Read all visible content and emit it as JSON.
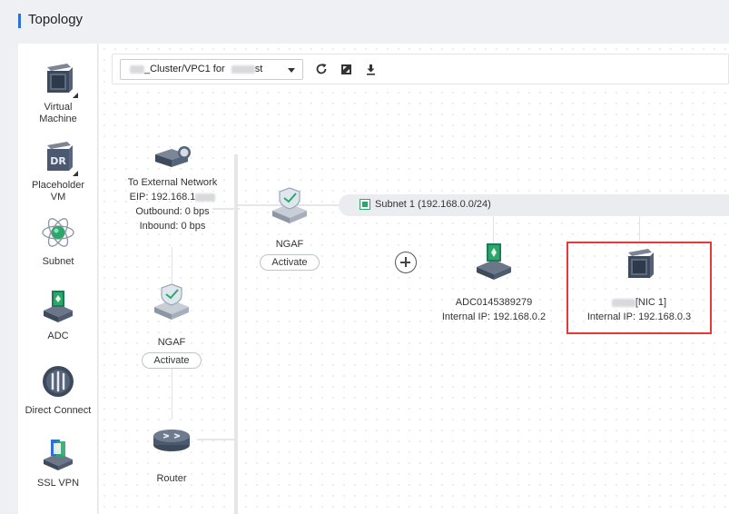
{
  "page": {
    "title": "Topology"
  },
  "palette": {
    "items": [
      {
        "label": "Virtual\nMachine",
        "icon": "vm-server-icon"
      },
      {
        "label": "Placeholder\nVM",
        "icon": "dr-server-icon"
      },
      {
        "label": "Subnet",
        "icon": "subnet-globe-icon"
      },
      {
        "label": "ADC",
        "icon": "adc-icon"
      },
      {
        "label": "Direct Connect",
        "icon": "direct-connect-icon"
      },
      {
        "label": "SSL VPN",
        "icon": "ssl-vpn-icon"
      }
    ]
  },
  "toolbar": {
    "selected_vpc": "_Cluster/VPC1 for",
    "selected_vpc_suffix": "st",
    "refresh_icon": "refresh-icon",
    "fullscreen_icon": "fullscreen-icon",
    "download_icon": "download-icon"
  },
  "topology": {
    "external": {
      "title": "To External Network",
      "eip_label": "EIP: 192.168.1",
      "outbound": "Outbound: 0 bps",
      "inbound": "Inbound: 0 bps"
    },
    "ngaf_top": {
      "label": "NGAF",
      "action": "Activate"
    },
    "ngaf_left": {
      "label": "NGAF",
      "action": "Activate"
    },
    "router": {
      "label": "Router"
    },
    "subnet": {
      "label": "Subnet 1 (192.168.0.0/24)"
    },
    "adc": {
      "name": "ADC0145389279",
      "ip": "Internal IP: 192.168.0.2"
    },
    "vm": {
      "name_suffix": "[NIC 1]",
      "ip": "Internal IP: 192.168.0.3"
    }
  },
  "colors": {
    "accent": "#2f6fd6",
    "highlight": "#e53935",
    "subnet_green": "#2aa86a"
  }
}
